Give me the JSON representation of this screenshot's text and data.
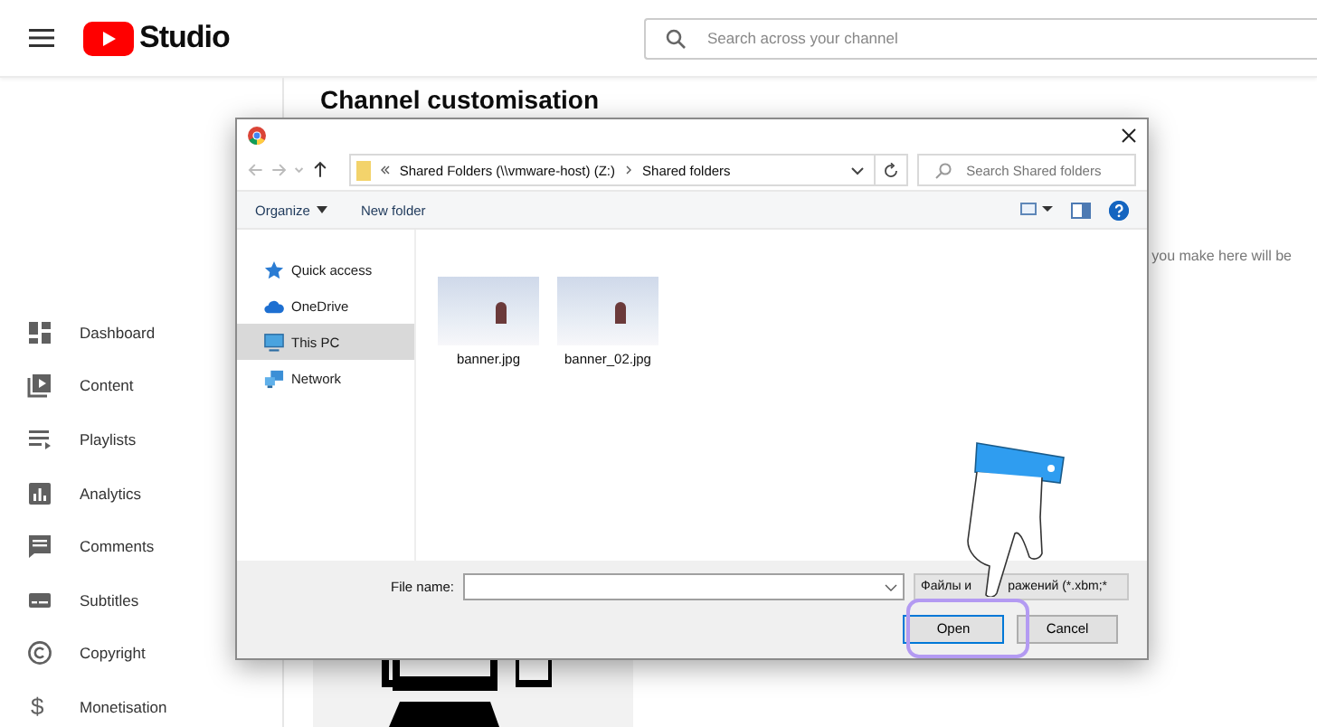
{
  "header": {
    "logo_text": "Studio",
    "search": {
      "placeholder": "Search across your channel"
    }
  },
  "sidebar": {
    "items": [
      {
        "label": "Dashboard",
        "kind": "dashboard"
      },
      {
        "label": "Content",
        "kind": "content"
      },
      {
        "label": "Playlists",
        "kind": "playlists"
      },
      {
        "label": "Analytics",
        "kind": "analytics"
      },
      {
        "label": "Comments",
        "kind": "comments"
      },
      {
        "label": "Subtitles",
        "kind": "subtitles"
      },
      {
        "label": "Copyright",
        "kind": "copyright"
      },
      {
        "label": "Monetisation",
        "kind": "monetisation",
        "glyph": "$"
      }
    ]
  },
  "page": {
    "title": "Channel customisation",
    "note": "you make here will be"
  },
  "dialog": {
    "path": [
      "Shared Folders (\\\\vmware-host) (Z:)",
      "Shared folders"
    ],
    "search": {
      "placeholder": "Search Shared folders"
    },
    "toolbar": [
      {
        "label": "Organize",
        "dropdown": true
      },
      {
        "label": "New folder",
        "dropdown": false
      }
    ],
    "nav": [
      {
        "label": "Quick access",
        "kind": "star",
        "selected": false
      },
      {
        "label": "OneDrive",
        "kind": "cloud",
        "selected": false
      },
      {
        "label": "This PC",
        "kind": "computer",
        "selected": true
      },
      {
        "label": "Network",
        "kind": "network",
        "selected": false
      }
    ],
    "files": [
      {
        "name": "banner.jpg"
      },
      {
        "name": "banner_02.jpg"
      }
    ],
    "filename": {
      "label": "File name:"
    },
    "filetype": [
      "Файлы и",
      "ражений (*.xbm;*"
    ],
    "buttons": [
      {
        "label": "Open",
        "highlighted": true
      },
      {
        "label": "Cancel",
        "highlighted": false
      }
    ]
  }
}
